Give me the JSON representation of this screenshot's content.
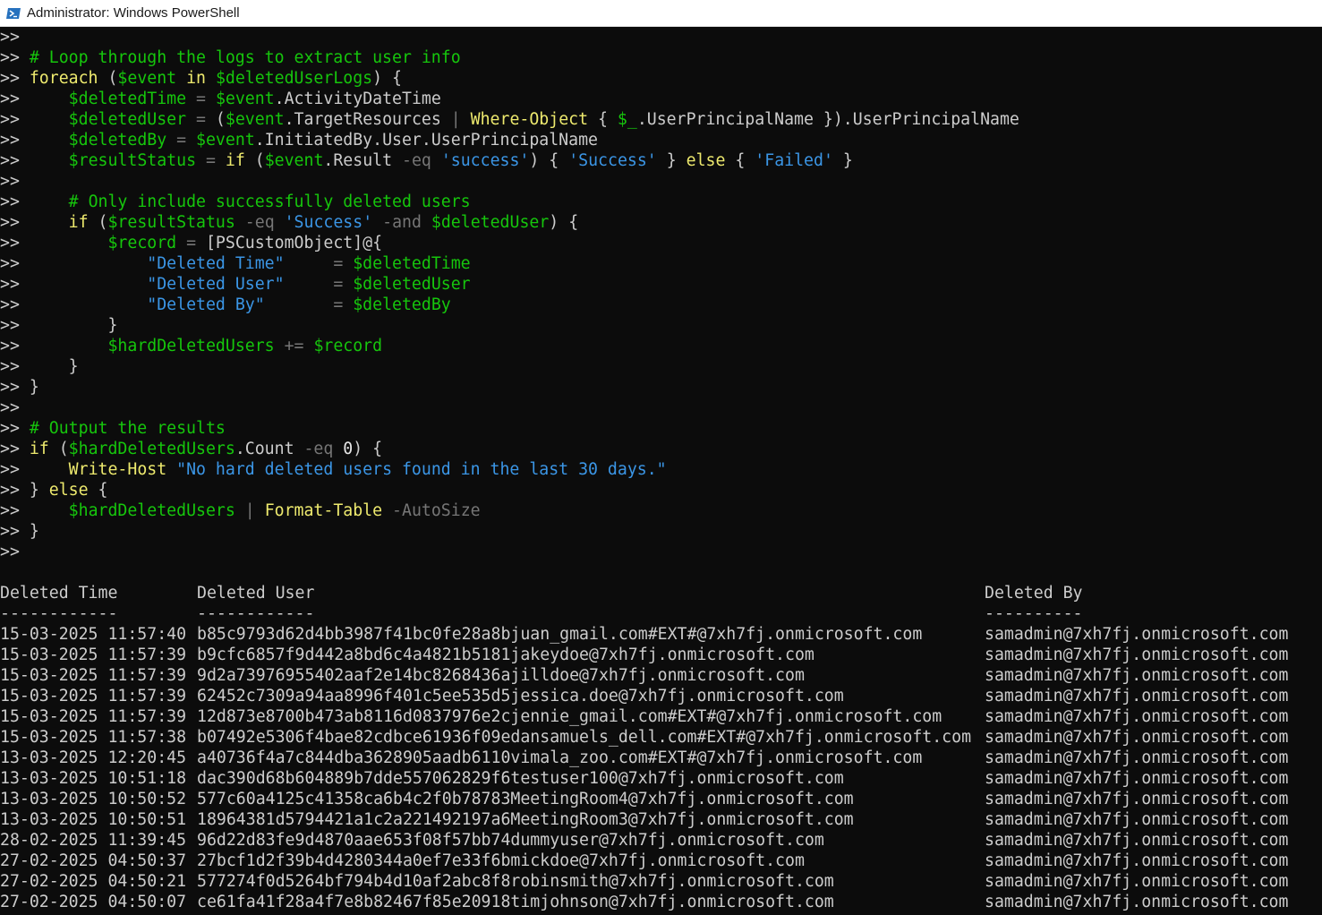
{
  "window": {
    "title": "Administrator: Windows PowerShell",
    "icon": "powershell-icon"
  },
  "prompt": ">>",
  "script_lines": [
    [],
    [
      [
        "c",
        "# Loop through the logs to extract user info"
      ]
    ],
    [
      [
        "k",
        "foreach"
      ],
      [
        "t",
        " ("
      ],
      [
        "v",
        "$event"
      ],
      [
        "t",
        " "
      ],
      [
        "k",
        "in"
      ],
      [
        "t",
        " "
      ],
      [
        "v",
        "$deletedUserLogs"
      ],
      [
        "t",
        ") {"
      ]
    ],
    [
      [
        "t",
        "    "
      ],
      [
        "v",
        "$deletedTime"
      ],
      [
        "t",
        " "
      ],
      [
        "o",
        "="
      ],
      [
        "t",
        " "
      ],
      [
        "v",
        "$event"
      ],
      [
        "t",
        ".ActivityDateTime"
      ]
    ],
    [
      [
        "t",
        "    "
      ],
      [
        "v",
        "$deletedUser"
      ],
      [
        "t",
        " "
      ],
      [
        "o",
        "="
      ],
      [
        "t",
        " ("
      ],
      [
        "v",
        "$event"
      ],
      [
        "t",
        ".TargetResources "
      ],
      [
        "o",
        "|"
      ],
      [
        "t",
        " "
      ],
      [
        "k",
        "Where-Object"
      ],
      [
        "t",
        " { "
      ],
      [
        "v",
        "$_"
      ],
      [
        "t",
        ".UserPrincipalName }).UserPrincipalName"
      ]
    ],
    [
      [
        "t",
        "    "
      ],
      [
        "v",
        "$deletedBy"
      ],
      [
        "t",
        " "
      ],
      [
        "o",
        "="
      ],
      [
        "t",
        " "
      ],
      [
        "v",
        "$event"
      ],
      [
        "t",
        ".InitiatedBy.User.UserPrincipalName"
      ]
    ],
    [
      [
        "t",
        "    "
      ],
      [
        "v",
        "$resultStatus"
      ],
      [
        "t",
        " "
      ],
      [
        "o",
        "="
      ],
      [
        "t",
        " "
      ],
      [
        "k",
        "if"
      ],
      [
        "t",
        " ("
      ],
      [
        "v",
        "$event"
      ],
      [
        "t",
        ".Result "
      ],
      [
        "o",
        "-eq"
      ],
      [
        "t",
        " "
      ],
      [
        "s",
        "'success'"
      ],
      [
        "t",
        ") { "
      ],
      [
        "s",
        "'Success'"
      ],
      [
        "t",
        " } "
      ],
      [
        "k",
        "else"
      ],
      [
        "t",
        " { "
      ],
      [
        "s",
        "'Failed'"
      ],
      [
        "t",
        " }"
      ]
    ],
    [],
    [
      [
        "t",
        "    "
      ],
      [
        "c",
        "# Only include successfully deleted users"
      ]
    ],
    [
      [
        "t",
        "    "
      ],
      [
        "k",
        "if"
      ],
      [
        "t",
        " ("
      ],
      [
        "v",
        "$resultStatus"
      ],
      [
        "t",
        " "
      ],
      [
        "o",
        "-eq"
      ],
      [
        "t",
        " "
      ],
      [
        "s",
        "'Success'"
      ],
      [
        "t",
        " "
      ],
      [
        "o",
        "-and"
      ],
      [
        "t",
        " "
      ],
      [
        "v",
        "$deletedUser"
      ],
      [
        "t",
        ") {"
      ]
    ],
    [
      [
        "t",
        "        "
      ],
      [
        "v",
        "$record"
      ],
      [
        "t",
        " "
      ],
      [
        "o",
        "="
      ],
      [
        "t",
        " [PSCustomObject]@{"
      ]
    ],
    [
      [
        "t",
        "            "
      ],
      [
        "s",
        "\"Deleted Time\""
      ],
      [
        "t",
        "     "
      ],
      [
        "o",
        "="
      ],
      [
        "t",
        " "
      ],
      [
        "v",
        "$deletedTime"
      ]
    ],
    [
      [
        "t",
        "            "
      ],
      [
        "s",
        "\"Deleted User\""
      ],
      [
        "t",
        "     "
      ],
      [
        "o",
        "="
      ],
      [
        "t",
        " "
      ],
      [
        "v",
        "$deletedUser"
      ]
    ],
    [
      [
        "t",
        "            "
      ],
      [
        "s",
        "\"Deleted By\""
      ],
      [
        "t",
        "       "
      ],
      [
        "o",
        "="
      ],
      [
        "t",
        " "
      ],
      [
        "v",
        "$deletedBy"
      ]
    ],
    [
      [
        "t",
        "        }"
      ]
    ],
    [
      [
        "t",
        "        "
      ],
      [
        "v",
        "$hardDeletedUsers"
      ],
      [
        "t",
        " "
      ],
      [
        "o",
        "+="
      ],
      [
        "t",
        " "
      ],
      [
        "v",
        "$record"
      ]
    ],
    [
      [
        "t",
        "    }"
      ]
    ],
    [
      [
        "t",
        "}"
      ]
    ],
    [],
    [
      [
        "c",
        "# Output the results"
      ]
    ],
    [
      [
        "k",
        "if"
      ],
      [
        "t",
        " ("
      ],
      [
        "v",
        "$hardDeletedUsers"
      ],
      [
        "t",
        ".Count "
      ],
      [
        "o",
        "-eq"
      ],
      [
        "t",
        " "
      ],
      [
        "n",
        "0"
      ],
      [
        "t",
        ") {"
      ]
    ],
    [
      [
        "t",
        "    "
      ],
      [
        "k",
        "Write-Host"
      ],
      [
        "t",
        " "
      ],
      [
        "s",
        "\"No hard deleted users found in the last 30 days.\""
      ]
    ],
    [
      [
        "t",
        "} "
      ],
      [
        "k",
        "else"
      ],
      [
        "t",
        " {"
      ]
    ],
    [
      [
        "t",
        "    "
      ],
      [
        "v",
        "$hardDeletedUsers"
      ],
      [
        "t",
        " "
      ],
      [
        "o",
        "|"
      ],
      [
        "t",
        " "
      ],
      [
        "k",
        "Format-Table"
      ],
      [
        "t",
        " "
      ],
      [
        "o",
        "-AutoSize"
      ]
    ],
    [
      [
        "t",
        "}"
      ]
    ],
    []
  ],
  "table": {
    "headers": [
      "Deleted Time",
      "Deleted User",
      "Deleted By"
    ],
    "underlines": [
      "------------",
      "------------",
      "----------"
    ],
    "rows": [
      [
        "15-03-2025 11:57:40",
        "b85c9793d62d4bb3987f41bc0fe28a8bjuan_gmail.com#EXT#@7xh7fj.onmicrosoft.com",
        "samadmin@7xh7fj.onmicrosoft.com"
      ],
      [
        "15-03-2025 11:57:39",
        "b9cfc6857f9d442a8bd6c4a4821b5181jakeydoe@7xh7fj.onmicrosoft.com",
        "samadmin@7xh7fj.onmicrosoft.com"
      ],
      [
        "15-03-2025 11:57:39",
        "9d2a73976955402aaf2e14bc8268436ajilldoe@7xh7fj.onmicrosoft.com",
        "samadmin@7xh7fj.onmicrosoft.com"
      ],
      [
        "15-03-2025 11:57:39",
        "62452c7309a94aa8996f401c5ee535d5jessica.doe@7xh7fj.onmicrosoft.com",
        "samadmin@7xh7fj.onmicrosoft.com"
      ],
      [
        "15-03-2025 11:57:39",
        "12d873e8700b473ab8116d0837976e2cjennie_gmail.com#EXT#@7xh7fj.onmicrosoft.com",
        "samadmin@7xh7fj.onmicrosoft.com"
      ],
      [
        "15-03-2025 11:57:38",
        "b07492e5306f4bae82cdbce61936f09edansamuels_dell.com#EXT#@7xh7fj.onmicrosoft.com",
        "samadmin@7xh7fj.onmicrosoft.com"
      ],
      [
        "13-03-2025 12:20:45",
        "a40736f4a7c844dba3628905aadb6110vimala_zoo.com#EXT#@7xh7fj.onmicrosoft.com",
        "samadmin@7xh7fj.onmicrosoft.com"
      ],
      [
        "13-03-2025 10:51:18",
        "dac390d68b604889b7dde557062829f6testuser100@7xh7fj.onmicrosoft.com",
        "samadmin@7xh7fj.onmicrosoft.com"
      ],
      [
        "13-03-2025 10:50:52",
        "577c60a4125c41358ca6b4c2f0b78783MeetingRoom4@7xh7fj.onmicrosoft.com",
        "samadmin@7xh7fj.onmicrosoft.com"
      ],
      [
        "13-03-2025 10:50:51",
        "18964381d5794421a1c2a221492197a6MeetingRoom3@7xh7fj.onmicrosoft.com",
        "samadmin@7xh7fj.onmicrosoft.com"
      ],
      [
        "28-02-2025 11:39:45",
        "96d22d83fe9d4870aae653f08f57bb74dummyuser@7xh7fj.onmicrosoft.com",
        "samadmin@7xh7fj.onmicrosoft.com"
      ],
      [
        "27-02-2025 04:50:37",
        "27bcf1d2f39b4d4280344a0ef7e33f6bmickdoe@7xh7fj.onmicrosoft.com",
        "samadmin@7xh7fj.onmicrosoft.com"
      ],
      [
        "27-02-2025 04:50:21",
        "577274f0d5264bf794b4d10af2abc8f8robinsmith@7xh7fj.onmicrosoft.com",
        "samadmin@7xh7fj.onmicrosoft.com"
      ],
      [
        "27-02-2025 04:50:07",
        "ce61fa41f28a4f7e8b82467f85e20918timjohnson@7xh7fj.onmicrosoft.com",
        "samadmin@7xh7fj.onmicrosoft.com"
      ]
    ]
  }
}
